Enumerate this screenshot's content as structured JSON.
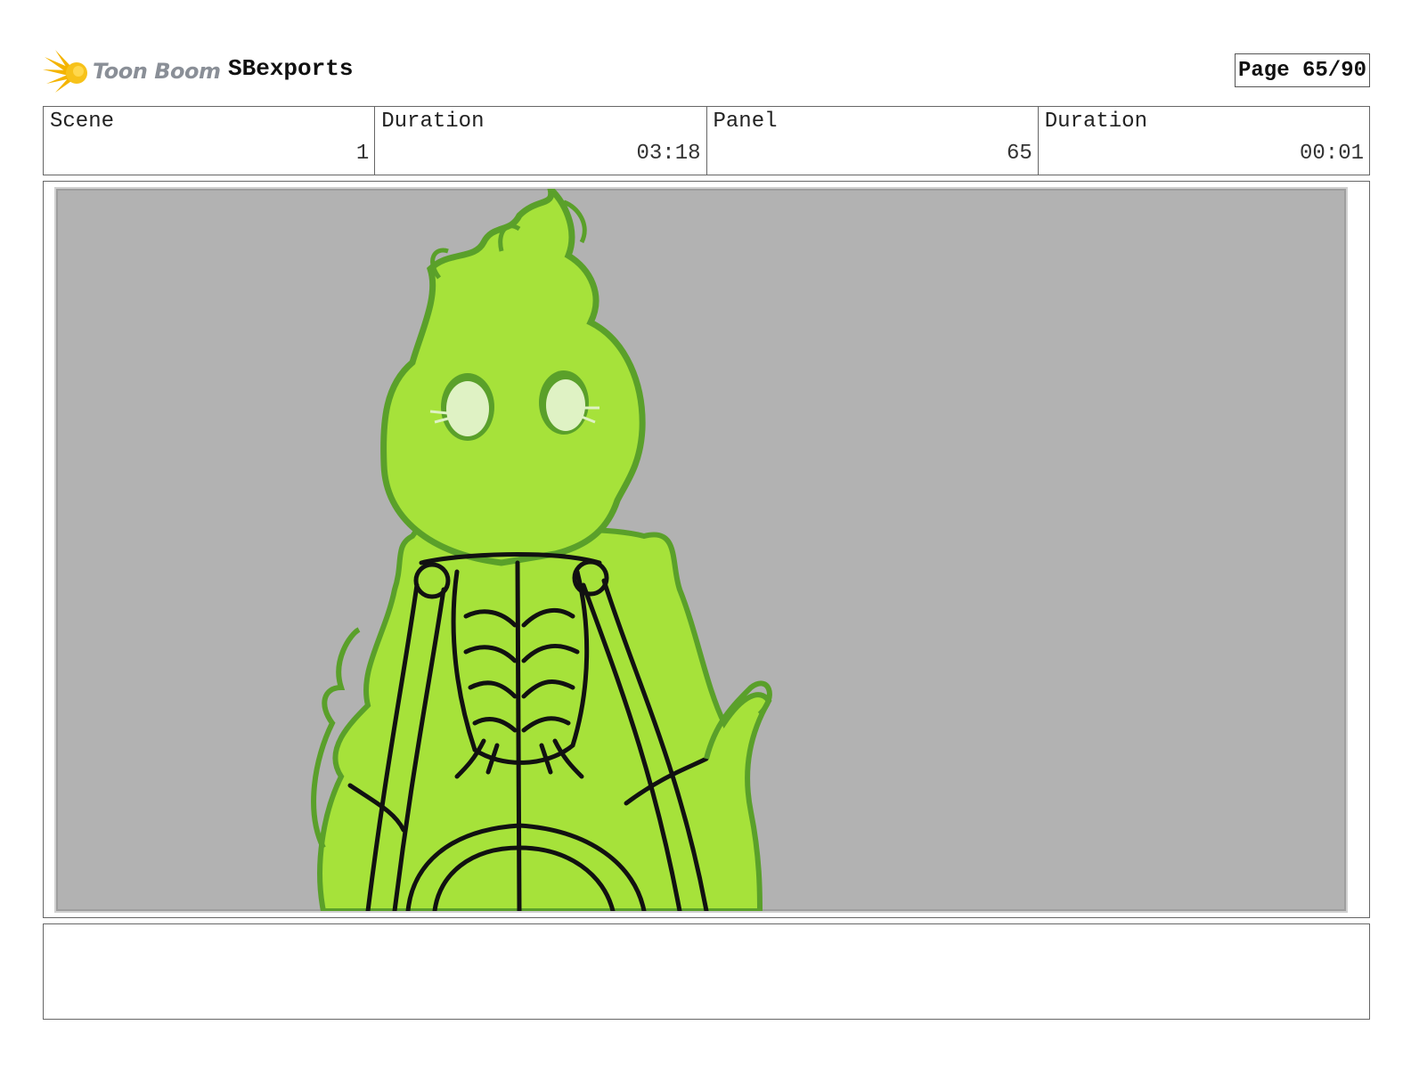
{
  "header": {
    "logo_text": "Toon Boom",
    "project_name": "SBexports",
    "page_label": "Page 65/90"
  },
  "info": {
    "scene_label": "Scene",
    "scene_value": "1",
    "scene_duration_label": "Duration",
    "scene_duration_value": "03:18",
    "panel_label": "Panel",
    "panel_value": "65",
    "panel_duration_label": "Duration",
    "panel_duration_value": "00:01"
  },
  "colors": {
    "background": "#b2b2b2",
    "flame_light": "#a6e23a",
    "flame_dark": "#5aa02a",
    "eye": "#dff2c4",
    "line": "#111111"
  },
  "notes": {
    "text": ""
  }
}
